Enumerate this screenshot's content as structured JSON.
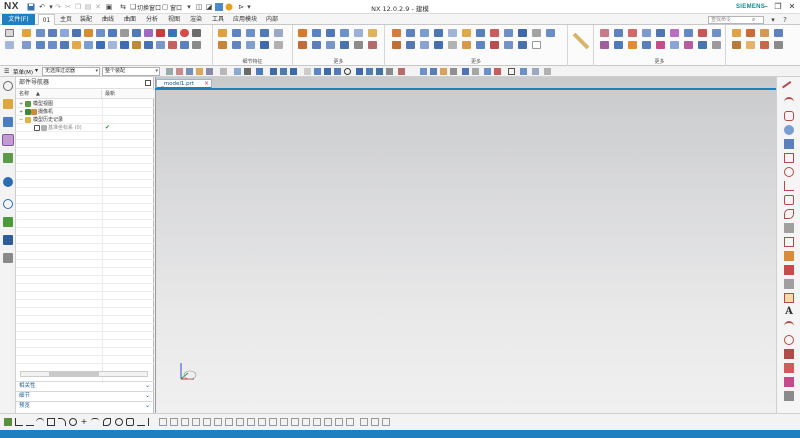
{
  "app": {
    "logo": "NX",
    "window_title": "NX 12.0.2.9 - 建模",
    "brand": "SIEMENS",
    "brand_color": "#0d8f8f",
    "accent_color": "#1f7fbf",
    "switch_window_label": "切换窗口",
    "window_menu_label": "窗口"
  },
  "menu": {
    "file_tab": "文件(F)",
    "tabs": [
      "01",
      "主页",
      "装配",
      "曲线",
      "曲面",
      "分析",
      "视图",
      "渲染",
      "工具",
      "应用模块",
      "内部"
    ],
    "active_tab": "01",
    "search_placeholder": "查找命令"
  },
  "ribbon": {
    "groups": [
      {
        "label": ""
      },
      {
        "label": ""
      },
      {
        "label": "细节特征"
      },
      {
        "label": "更多"
      },
      {
        "label": "更多"
      },
      {
        "label": "更多"
      },
      {
        "label": ""
      }
    ]
  },
  "selection_bar": {
    "menu_label": "菜单(M)",
    "filter_value": "无选择过滤器",
    "scope_value": "整个装配"
  },
  "navigator": {
    "title": "部件导航器",
    "columns": [
      "名称",
      "最新"
    ],
    "tree": [
      {
        "label": "模型视图",
        "level": 0,
        "expand": "+",
        "icon": "model-views-icon"
      },
      {
        "label": "摄像机",
        "level": 0,
        "expand": "+",
        "icon": "camera-icon"
      },
      {
        "label": "模型历史记录",
        "level": 0,
        "expand": "−",
        "icon": "history-icon"
      },
      {
        "label": "基准坐标系 (0)",
        "level": 1,
        "expand": "",
        "icon": "datum-csys-icon",
        "latest": "✔"
      }
    ],
    "panels": [
      "相关性",
      "细节",
      "预览"
    ]
  },
  "graphics": {
    "tab_label": "_model1.prt"
  }
}
